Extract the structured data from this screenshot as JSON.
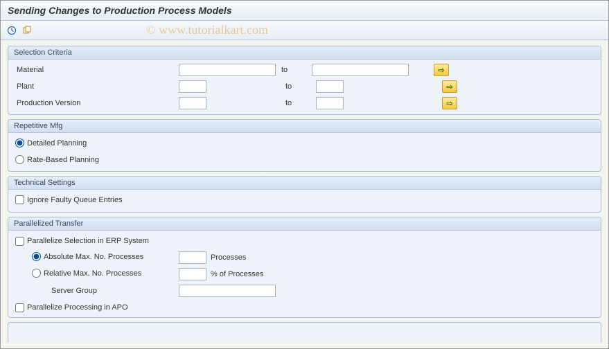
{
  "title": "Sending Changes to Production Process Models",
  "watermark": "© www.tutorialkart.com",
  "groups": {
    "selection": {
      "title": "Selection Criteria",
      "material_label": "Material",
      "plant_label": "Plant",
      "prodver_label": "Production Version",
      "to_label": "to",
      "material_from": "",
      "material_to": "",
      "plant_from": "",
      "plant_to": "",
      "prodver_from": "",
      "prodver_to": ""
    },
    "repetitive": {
      "title": "Repetitive Mfg",
      "detailed_label": "Detailed Planning",
      "rate_label": "Rate-Based Planning"
    },
    "technical": {
      "title": "Technical Settings",
      "ignore_faulty_label": "Ignore Faulty Queue Entries"
    },
    "parallel": {
      "title": "Parallelized Transfer",
      "parallelize_erp_label": "Parallelize Selection in ERP System",
      "abs_max_label": "Absolute Max. No. Processes",
      "rel_max_label": "Relative Max. No. Processes",
      "server_group_label": "Server Group",
      "processes_suffix": "Processes",
      "pct_suffix": "% of Processes",
      "parallelize_apo_label": "Parallelize Processing in APO",
      "abs_max_val": "",
      "rel_max_val": "",
      "server_group_val": ""
    }
  }
}
